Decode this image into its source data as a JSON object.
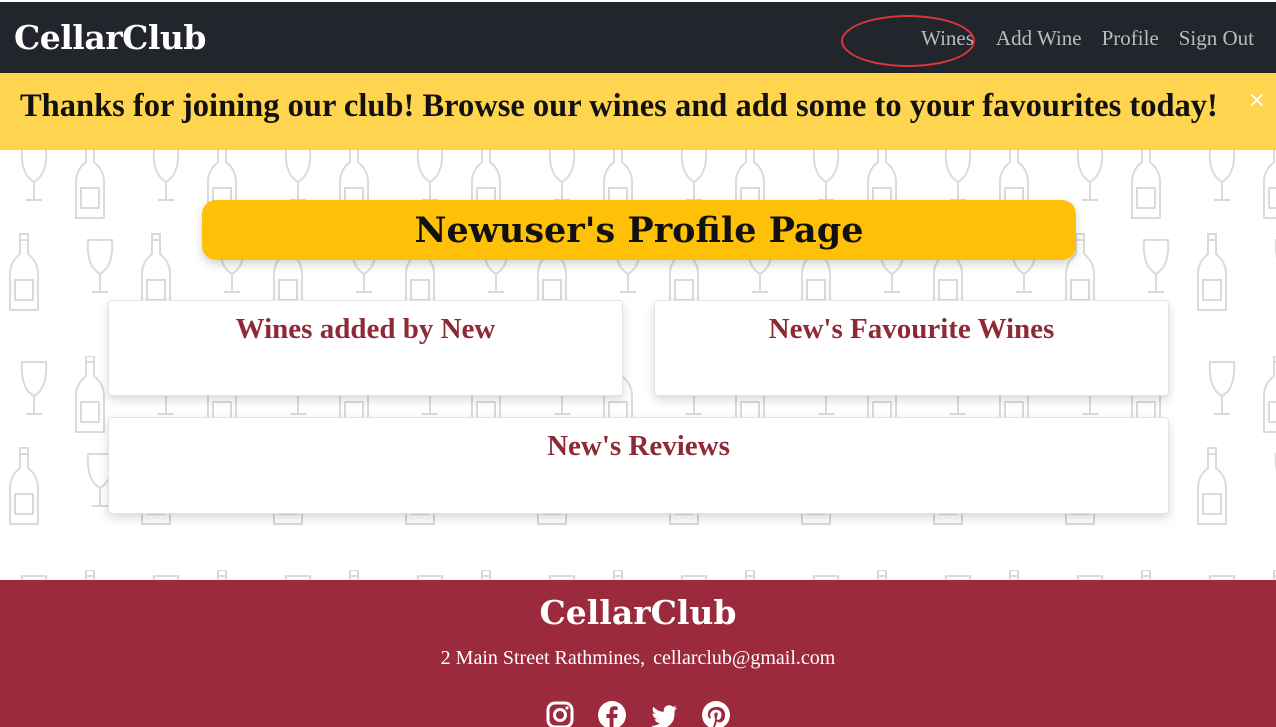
{
  "navbar": {
    "brand": "CellarClub",
    "links": [
      {
        "label": "Wines"
      },
      {
        "label": "Add Wine"
      },
      {
        "label": "Profile"
      },
      {
        "label": "Sign Out"
      }
    ]
  },
  "alert": {
    "message": "Thanks for joining our club! Browse our wines and add some to your favourites today!",
    "close": "×"
  },
  "main": {
    "title": "Newuser's Profile Page",
    "cards": [
      {
        "title": "Wines added by New"
      },
      {
        "title": "New's Favourite Wines"
      },
      {
        "title": "New's Reviews"
      }
    ]
  },
  "footer": {
    "brand": "CellarClub",
    "address": "2 Main Street Rathmines,",
    "email": "cellarclub@gmail.com",
    "socials": [
      "instagram-icon",
      "facebook-icon",
      "twitter-icon",
      "pinterest-icon"
    ]
  },
  "colors": {
    "navbar": "#22252b",
    "alert": "#ffd54f",
    "title_pill": "#ffc107",
    "card_title": "#8e2a36",
    "footer": "#9b2a3c",
    "annotation": "#d9363e"
  }
}
